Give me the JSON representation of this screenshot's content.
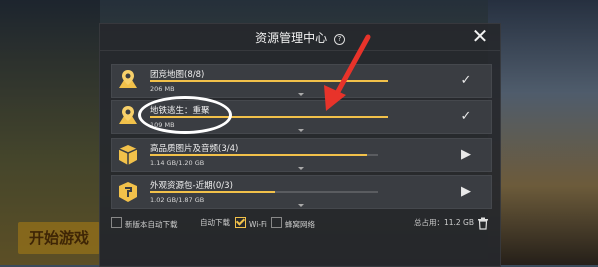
{
  "background": {
    "start_button_label": "开始游戏"
  },
  "dialog": {
    "title": "资源管理中心",
    "help_icon": "question-circle-icon",
    "close_icon": "close-x-icon",
    "items": [
      {
        "name": "团竞地图(8/8)",
        "size": "206 MB",
        "progress": 1.0,
        "status_icon": "check-icon",
        "icon": "map-pin-icon"
      },
      {
        "name": "地铁逃生：重聚",
        "size": "109 MB",
        "progress": 1.0,
        "status_icon": "check-icon",
        "icon": "map-pin-icon"
      },
      {
        "name": "高品质图片及音频(3/4)",
        "size": "1.14 GB/1.20 GB",
        "progress": 0.95,
        "status_icon": "play-icon",
        "icon": "package-box-icon"
      },
      {
        "name": "外观资源包-近期(0/3)",
        "size": "1.02 GB/1.87 GB",
        "progress": 0.55,
        "status_icon": "play-icon",
        "icon": "package-box-icon"
      }
    ],
    "footer": {
      "auto_update_new_label": "新版本自动下载",
      "auto_download_label": "自动下载",
      "wifi_label": "Wi-Fi",
      "cellular_label": "蜂窝网络",
      "total_label": "总占用：11.2 GB",
      "trash_icon": "trash-icon"
    }
  },
  "colors": {
    "accent": "#f2c14a",
    "panel_bg": "#26282c",
    "item_bg": "#3a3d42",
    "annotation": "#ffffff",
    "arrow": "#e8332a"
  }
}
